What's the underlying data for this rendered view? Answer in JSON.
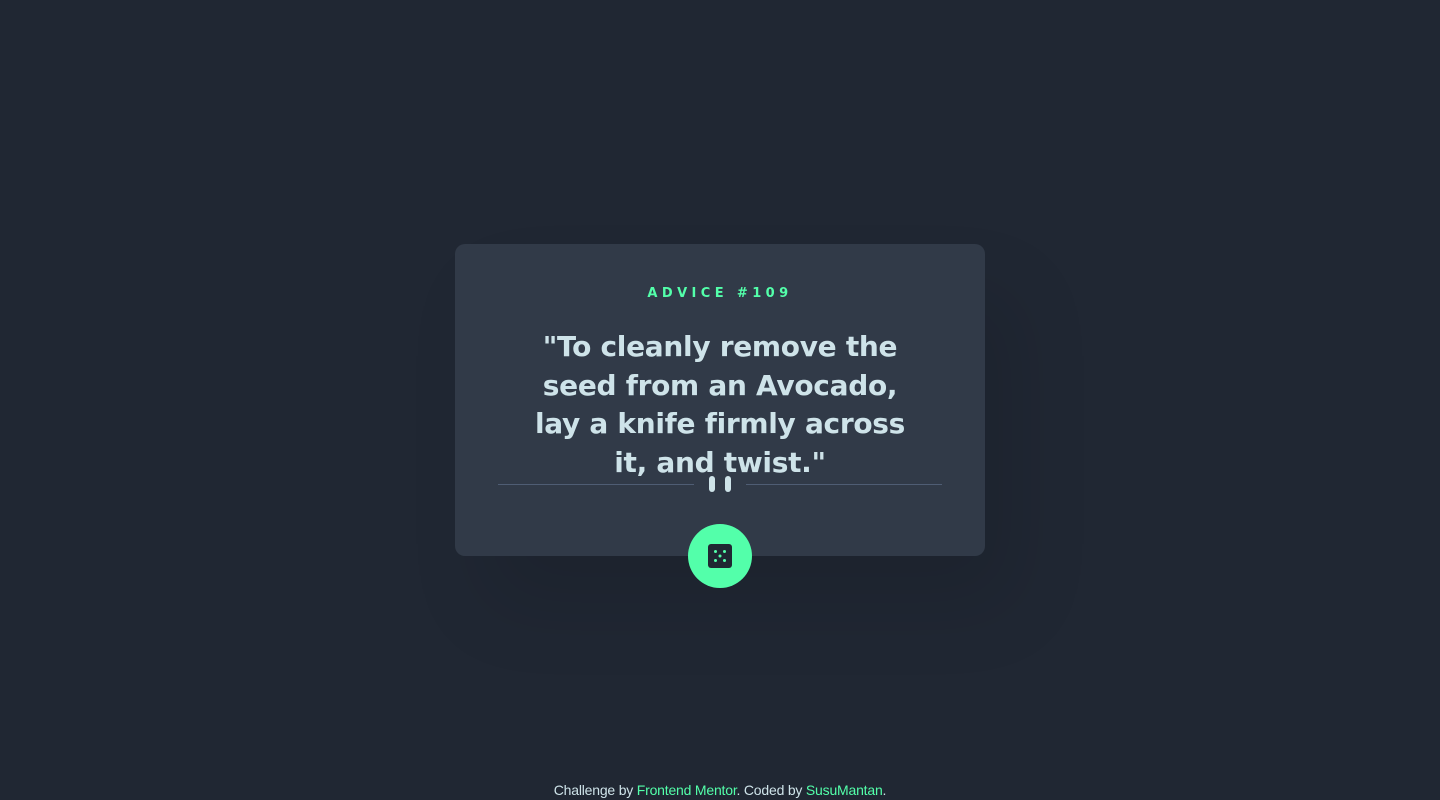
{
  "card": {
    "title": "ADVICE #109",
    "quote": "\"To cleanly remove the seed from an Avocado, lay a knife firmly across it, and twist.\""
  },
  "icons": {
    "divider": "pause-icon",
    "button": "dice-icon"
  },
  "footer": {
    "prefix": "Challenge by ",
    "link1": "Frontend Mentor",
    "middle": ". Coded by ",
    "link2": "SusuMantan",
    "suffix": "."
  },
  "colors": {
    "background": "#202733",
    "card": "#313a48",
    "accent": "#53ffaa",
    "text": "#cee3e9",
    "divider": "#4f5d74"
  }
}
